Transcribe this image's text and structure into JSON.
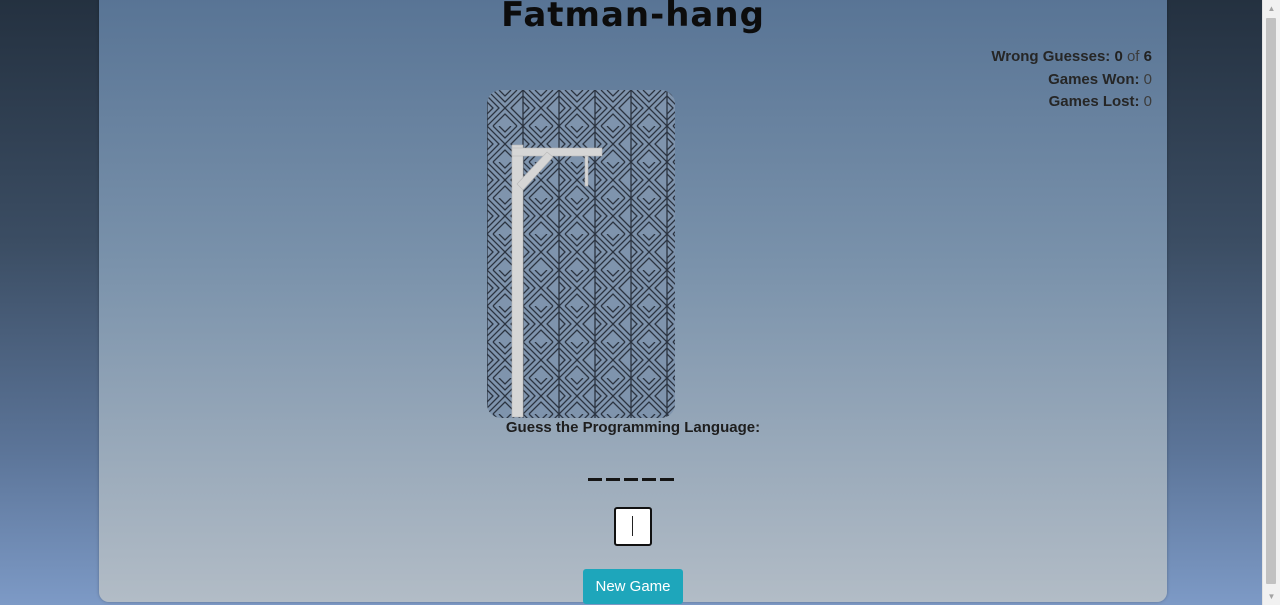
{
  "app": {
    "title": "Fatman-hang"
  },
  "stats": {
    "wrong_label": "Wrong Guesses:",
    "wrong_count": "0",
    "wrong_of": "of",
    "wrong_max": "6",
    "won_label": "Games Won:",
    "won_count": "0",
    "lost_label": "Games Lost:",
    "lost_count": "0"
  },
  "game": {
    "prompt": "Guess the Programming Language:",
    "word_length": 5,
    "guess_value": "",
    "new_game_label": "New Game"
  },
  "colors": {
    "button": "#1ea6bb",
    "gallows": "#d4d4d4",
    "pattern_line": "#2b3340"
  },
  "icons": {
    "gallows": "gallows-drawing",
    "scroll_up": "scroll-up-arrow",
    "scroll_down": "scroll-down-arrow"
  }
}
